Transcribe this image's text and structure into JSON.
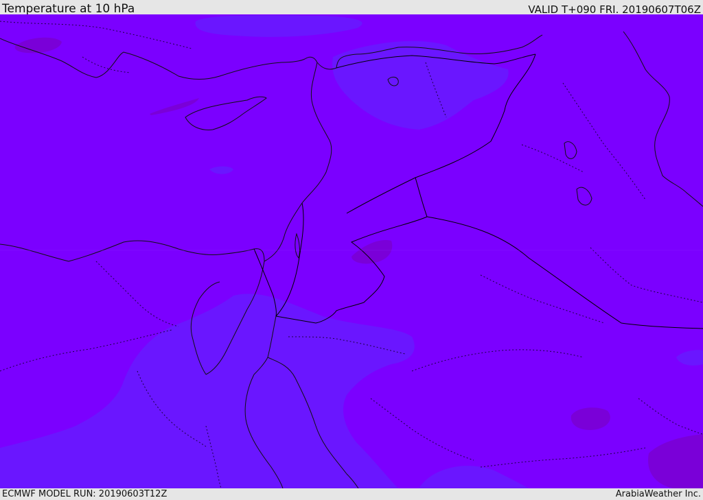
{
  "header": {
    "title": "Temperature at 10 hPa",
    "valid": "VALID T+090 FRI. 20190607T06Z"
  },
  "footer": {
    "model_run": "ECMWF MODEL RUN: 20190603T12Z",
    "credit": "ArabiaWeather Inc."
  },
  "map": {
    "colors": {
      "background": "#7b00ff",
      "cooler_zone": "#6a16ff",
      "warmer_zone": "#7a00d8",
      "coastline": "#101010",
      "borders": "#1a0040"
    }
  }
}
